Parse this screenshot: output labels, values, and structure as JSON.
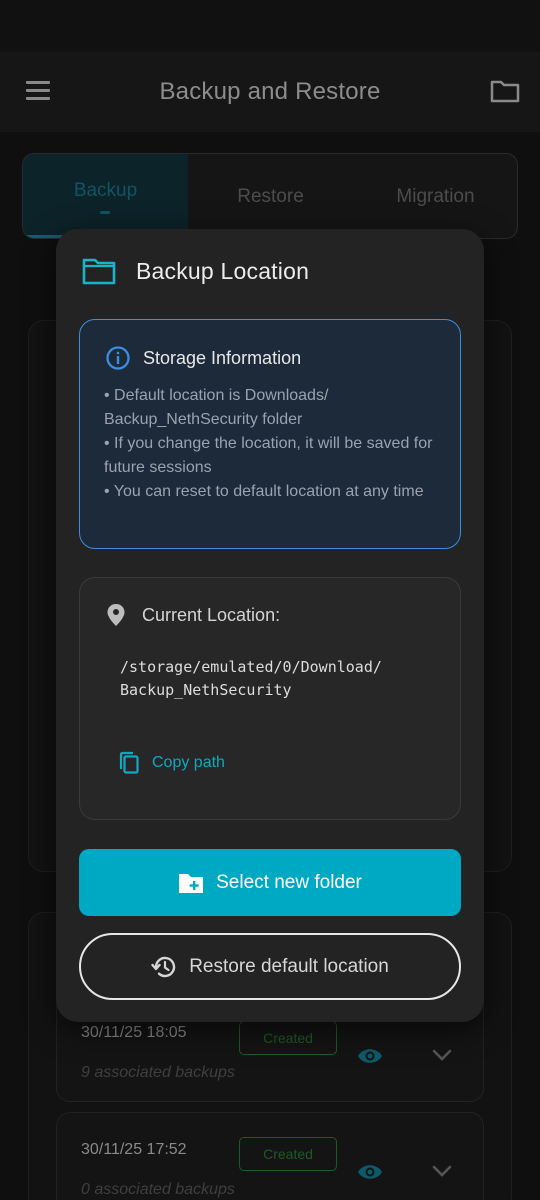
{
  "app_bar": {
    "title": "Backup and Restore"
  },
  "tabs": [
    {
      "label": "Backup"
    },
    {
      "label": "Restore"
    },
    {
      "label": "Migration"
    }
  ],
  "backups": [
    {
      "date": "30/11/25 18:05",
      "badge": "Created",
      "associated": "9 associated backups"
    },
    {
      "date": "30/11/25 17:52",
      "badge": "Created",
      "associated": "0 associated backups"
    }
  ],
  "dialog": {
    "title": "Backup Location",
    "info": {
      "title": "Storage Information",
      "lines": [
        "• Default location is Downloads/ Backup_NethSecurity folder",
        "• If you change the location, it will be saved for future sessions",
        "• You can reset to default location at any time"
      ]
    },
    "location": {
      "label": "Current Location:",
      "path_line1": "/storage/emulated/0/Download/",
      "path_line2": "Backup_NethSecurity",
      "copy_label": "Copy path"
    },
    "select_button": "Select new folder",
    "restore_button": "Restore default location"
  },
  "colors": {
    "accent": "#00a9c3",
    "info_border": "#3a8fe0",
    "info_bg": "#1d2a3a",
    "dialog_bg": "#232323",
    "badge_green": "#1f5a25"
  },
  "icons": {
    "menu": "menu-icon",
    "folder": "folder-icon",
    "info": "info-icon",
    "pin": "location-pin-icon",
    "copy": "copy-icon",
    "new_folder": "create-new-folder-icon",
    "history": "history-icon",
    "eye": "eye-icon",
    "chevron": "chevron-down-icon"
  }
}
